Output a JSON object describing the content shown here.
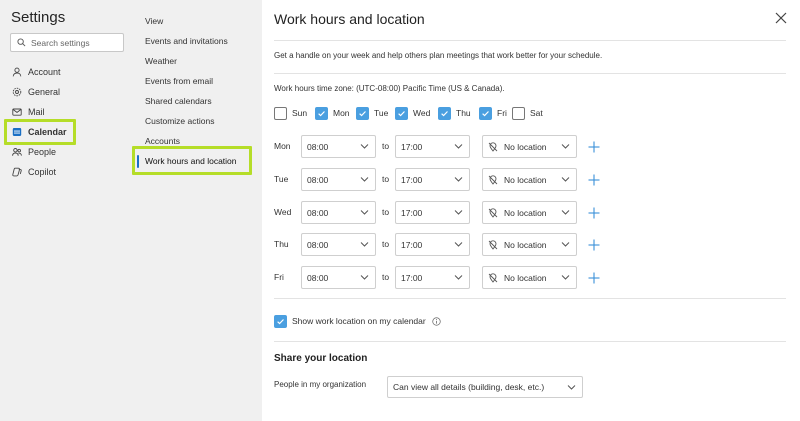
{
  "left_nav": {
    "title": "Settings",
    "search_placeholder": "Search settings",
    "items": [
      {
        "label": "Account",
        "icon": "person-icon"
      },
      {
        "label": "General",
        "icon": "gear-icon"
      },
      {
        "label": "Mail",
        "icon": "mail-icon"
      },
      {
        "label": "Calendar",
        "icon": "calendar-icon",
        "active": true
      },
      {
        "label": "People",
        "icon": "people-icon"
      },
      {
        "label": "Copilot",
        "icon": "copilot-icon"
      }
    ]
  },
  "sub_nav": {
    "items": [
      {
        "label": "View"
      },
      {
        "label": "Events and invitations"
      },
      {
        "label": "Weather"
      },
      {
        "label": "Events from email"
      },
      {
        "label": "Shared calendars"
      },
      {
        "label": "Customize actions"
      },
      {
        "label": "Accounts"
      },
      {
        "label": "Work hours and location",
        "active": true
      }
    ]
  },
  "highlight_color": "#b5dd28",
  "accent_color": "#4a9fe0",
  "main": {
    "title": "Work hours and location",
    "intro": "Get a handle on your week and help others plan meetings that work better for your schedule.",
    "timezone": "Work hours time zone: (UTC-08:00) Pacific Time (US & Canada).",
    "days": [
      {
        "label": "Sun",
        "checked": false
      },
      {
        "label": "Mon",
        "checked": true
      },
      {
        "label": "Tue",
        "checked": true
      },
      {
        "label": "Wed",
        "checked": true
      },
      {
        "label": "Thu",
        "checked": true
      },
      {
        "label": "Fri",
        "checked": true
      },
      {
        "label": "Sat",
        "checked": false
      }
    ],
    "to_label": "to",
    "rows": [
      {
        "day": "Mon",
        "start": "08:00",
        "end": "17:00",
        "location": "No location"
      },
      {
        "day": "Tue",
        "start": "08:00",
        "end": "17:00",
        "location": "No location"
      },
      {
        "day": "Wed",
        "start": "08:00",
        "end": "17:00",
        "location": "No location"
      },
      {
        "day": "Thu",
        "start": "08:00",
        "end": "17:00",
        "location": "No location"
      },
      {
        "day": "Fri",
        "start": "08:00",
        "end": "17:00",
        "location": "No location"
      }
    ],
    "show_location_label": "Show work location on my calendar",
    "show_location_checked": true,
    "share_title": "Share your location",
    "people_label": "People in my organization",
    "people_value": "Can view all details (building, desk, etc.)"
  }
}
